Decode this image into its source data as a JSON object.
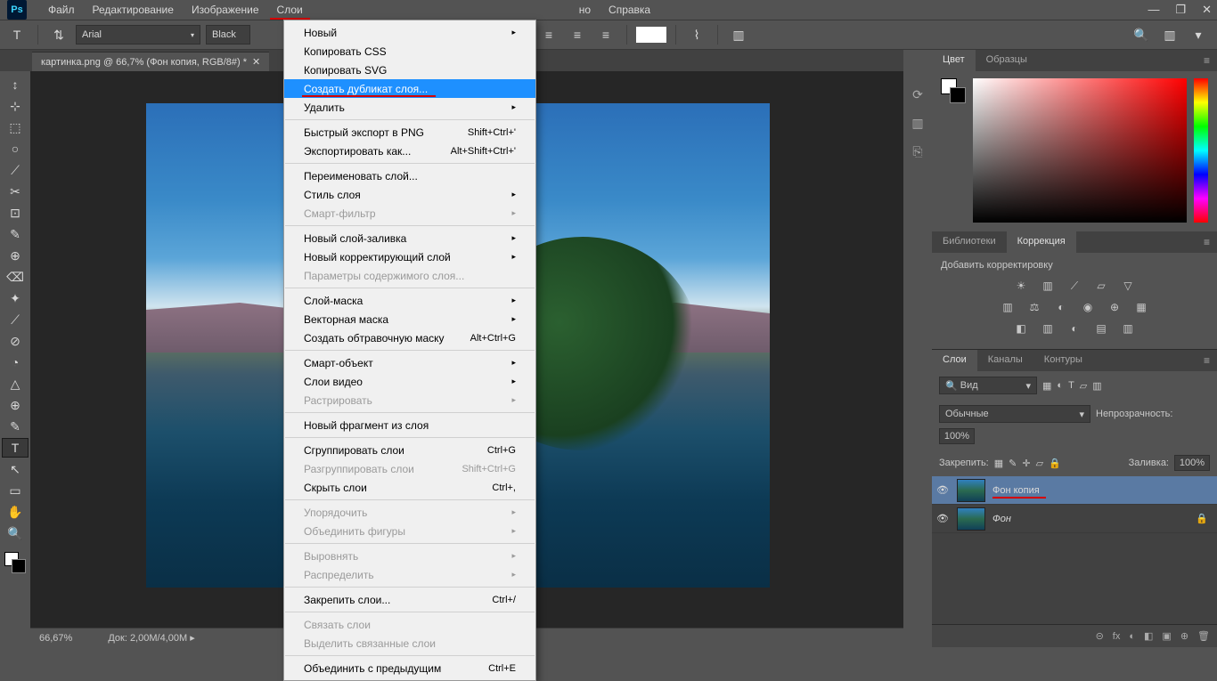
{
  "app": {
    "logo": "Ps"
  },
  "menubar": [
    "Файл",
    "Редактирование",
    "Изображение",
    "Слои"
  ],
  "menubar_rest": [
    "но",
    "Справка"
  ],
  "win": {
    "min": "—",
    "max": "❐",
    "close": "✕"
  },
  "optbar": {
    "font": "Arial",
    "color": "Black",
    "chev": "▾"
  },
  "tab": {
    "title": "картинка.png @ 66,7% (Фон копия, RGB/8#) *",
    "close": "✕"
  },
  "menu": {
    "new": "Новый",
    "copycss": "Копировать CSS",
    "copysvg": "Копировать SVG",
    "dup": "Создать дубликат слоя...",
    "del": "Удалить",
    "exportpng": "Быстрый экспорт в PNG",
    "exportpng_sc": "Shift+Ctrl+'",
    "exportas": "Экспортировать как...",
    "exportas_sc": "Alt+Shift+Ctrl+'",
    "rename": "Переименовать слой...",
    "lstyle": "Стиль слоя",
    "smartf": "Смарт-фильтр",
    "newfill": "Новый слой-заливка",
    "newadj": "Новый корректирующий слой",
    "copts": "Параметры содержимого слоя...",
    "lmask": "Слой-маска",
    "vmask": "Векторная маска",
    "clipmask": "Создать обтравочную маску",
    "clipmask_sc": "Alt+Ctrl+G",
    "smartobj": "Смарт-объект",
    "vidlayers": "Слои видео",
    "raster": "Растрировать",
    "newslice": "Новый фрагмент из слоя",
    "group": "Сгруппировать слои",
    "group_sc": "Ctrl+G",
    "ungroup": "Разгруппировать слои",
    "ungroup_sc": "Shift+Ctrl+G",
    "hide": "Скрыть слои",
    "hide_sc": "Ctrl+,",
    "arrange": "Упорядочить",
    "combine": "Объединить фигуры",
    "align": "Выровнять",
    "distribute": "Распределить",
    "lockl": "Закрепить слои...",
    "lockl_sc": "Ctrl+/",
    "link": "Связать слои",
    "sellink": "Выделить связанные слои",
    "mergedown": "Объединить с предыдущим",
    "mergedown_sc": "Ctrl+E",
    "arrow": "▸"
  },
  "panels": {
    "color_tab": "Цвет",
    "swatches_tab": "Образцы",
    "lib_tab": "Библиотеки",
    "adj_tab": "Коррекция",
    "adj_label": "Добавить корректировку",
    "layers_tab": "Слои",
    "channels_tab": "Каналы",
    "paths_tab": "Контуры",
    "kind": "Вид",
    "kind_chev": "▾",
    "blend": "Обычные",
    "blend_chev": "▾",
    "opacity_label": "Непрозрачность:",
    "opacity_val": "100%",
    "lock_label": "Закрепить:",
    "fill_label": "Заливка:",
    "fill_val": "100%",
    "search_icon": "🔍",
    "pmenu": "≡",
    "layer1": "Фон копия",
    "layer2": "Фон",
    "eye": "👁",
    "lock_icon": "🔒",
    "foot_icons": [
      "⊝",
      "fx",
      "◐",
      "◧",
      "▣",
      "⊕",
      "🗑"
    ]
  },
  "status": {
    "zoom": "66,67%",
    "doc_label": "Док:",
    "doc_size": "2,00M/4,00M",
    "arrow": "▸"
  },
  "icons": {
    "type": "T",
    "toggle": "⇅",
    "align_l": "≡",
    "align_c": "≡",
    "align_r": "≡",
    "warp": "⌇",
    "panel": "▥",
    "search": "🔍",
    "layout": "▥",
    "chevd": "▾"
  },
  "tools": [
    "↕",
    "⊹",
    "⬚",
    "○",
    "⟋",
    "✂",
    "⊡",
    "✎",
    "⊕",
    "⌫",
    "✦",
    "⟋",
    "⊘",
    "◔",
    "△",
    "⊕",
    "✎",
    "T",
    "↖",
    "▭",
    "✋",
    "🔍"
  ]
}
